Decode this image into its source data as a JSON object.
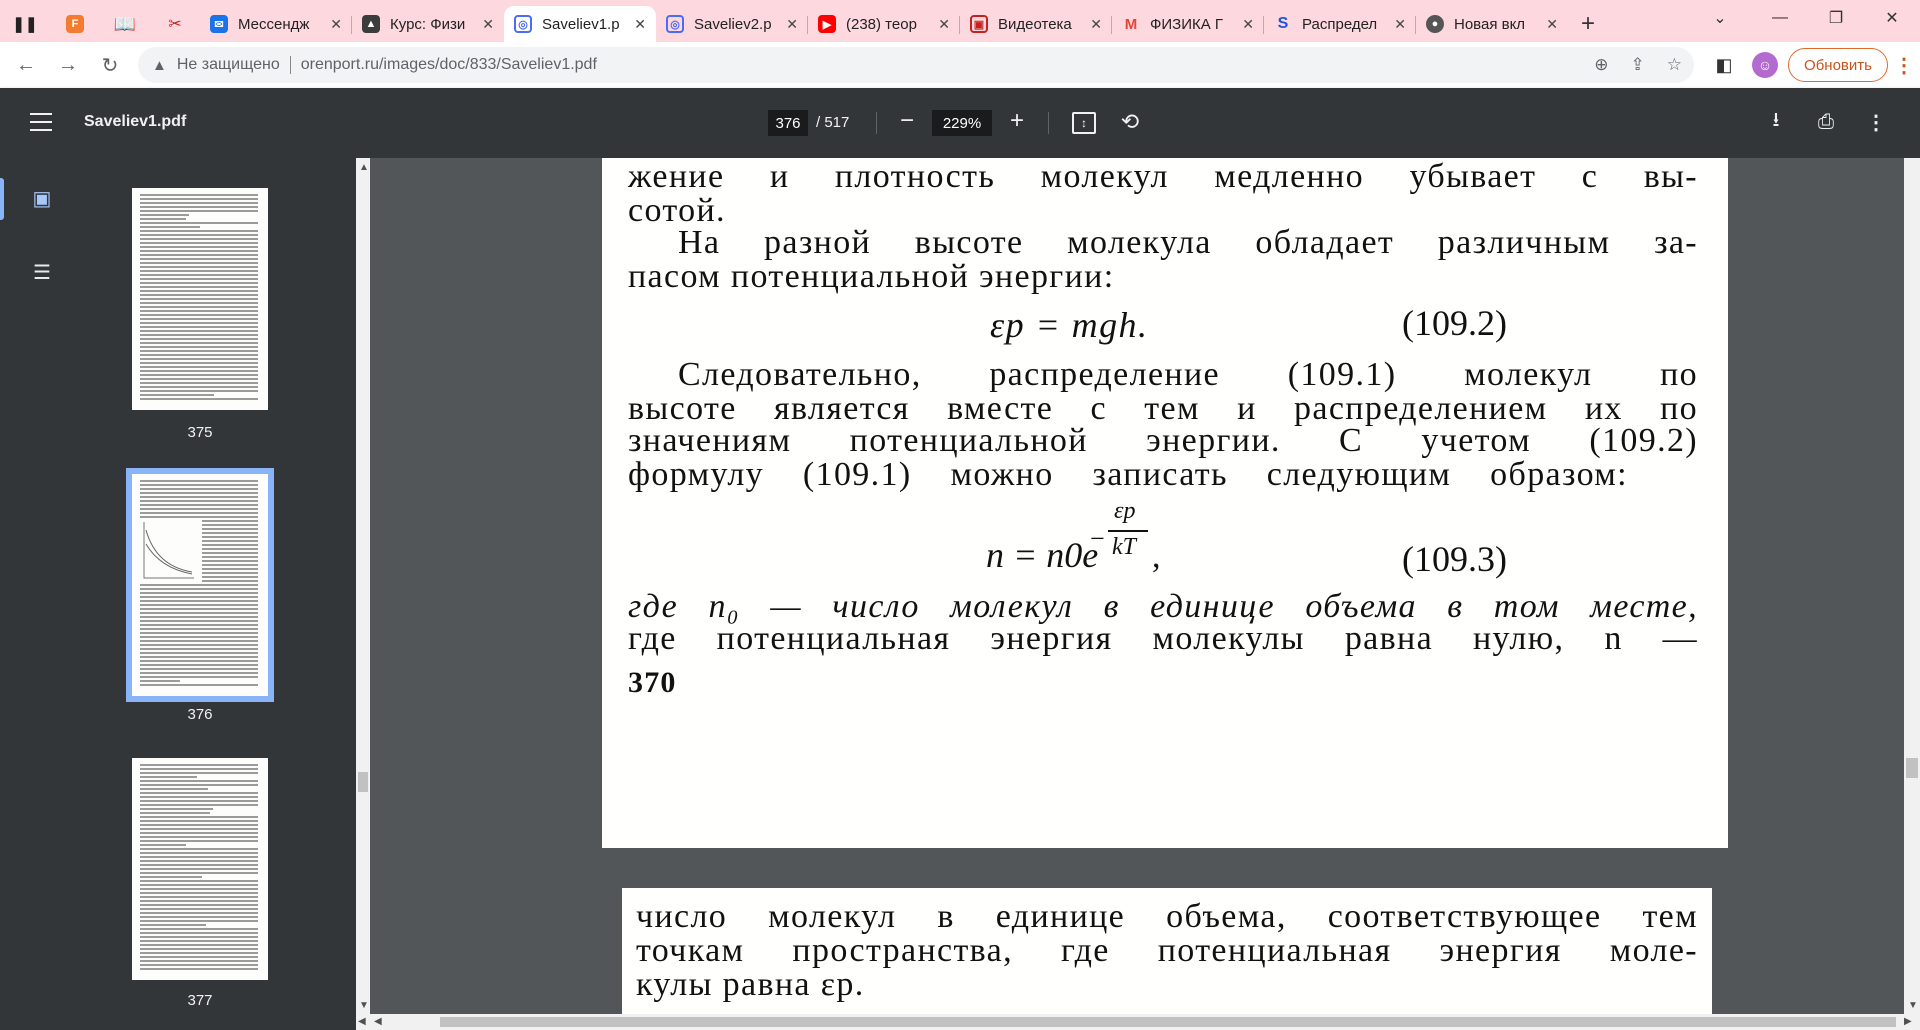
{
  "tabs": [
    {
      "title": "",
      "icon": "pause-icon"
    },
    {
      "title": "",
      "icon": "f-icon",
      "color": "#f47c30"
    },
    {
      "title": "",
      "icon": "book-icon"
    },
    {
      "title": "",
      "icon": "bug-icon"
    },
    {
      "title": "Мессендж",
      "icon": "messenger-icon",
      "color": "#1a73e8"
    },
    {
      "title": "Курс: Физи",
      "icon": "graduation-cap-icon",
      "color": "#3c3c3c"
    },
    {
      "title": "Saveliev1.p",
      "icon": "pdf-icon",
      "color": "#4a6cf7",
      "active": true
    },
    {
      "title": "Saveliev2.p",
      "icon": "pdf-icon",
      "color": "#4a6cf7"
    },
    {
      "title": "(238) теор",
      "icon": "youtube-icon",
      "color": "#ff0000"
    },
    {
      "title": "Видеотека",
      "icon": "video-library-icon",
      "color": "#c5221f"
    },
    {
      "title": "ФИЗИКА Г",
      "icon": "gmail-icon",
      "color": "#ea4335"
    },
    {
      "title": "Распредел",
      "icon": "s-icon",
      "color": "#1a56db"
    },
    {
      "title": "Новая вкл",
      "icon": "chrome-icon",
      "color": "#555"
    }
  ],
  "address": {
    "security": "Не защищено",
    "url": "orenport.ru/images/doc/833/Saveliev1.pdf",
    "update_label": "Обновить"
  },
  "pdf": {
    "title": "Saveliev1.pdf",
    "page": "376",
    "total": "/ 517",
    "zoom": "229%"
  },
  "thumbnails": [
    {
      "label": "375"
    },
    {
      "label": "376",
      "selected": true
    },
    {
      "label": "377"
    }
  ],
  "page1": {
    "lines": [
      "жение и плотность молекул медленно убывает с вы-",
      "сотой.",
      "На разной высоте молекула обладает различным за-",
      "пасом потенциальной энергии:",
      "Следовательно, распределение (109.1) молекул по",
      "высоте является вместе с тем и распределением их по",
      "значениям потенциальной энергии. С учетом (109.2)",
      "формулу (109.1) можно записать следующим образом:",
      "где n₀ — число молекул в единице объема в том месте,",
      "где потенциальная энергия молекулы равна нулю, n —"
    ],
    "eq1": "εp = mgh.",
    "eq1_num": "(109.2)",
    "eq2_base": "n = n0e",
    "eq2_exp_num": "εp",
    "eq2_exp_den": "kT",
    "eq2_num": "(109.3)",
    "page_number": "370"
  },
  "page2": {
    "lines": [
      "число молекул в единице объема, соответствующее тем",
      "точкам пространства, где потенциальная энергия моле-",
      "кулы равна εp."
    ]
  }
}
